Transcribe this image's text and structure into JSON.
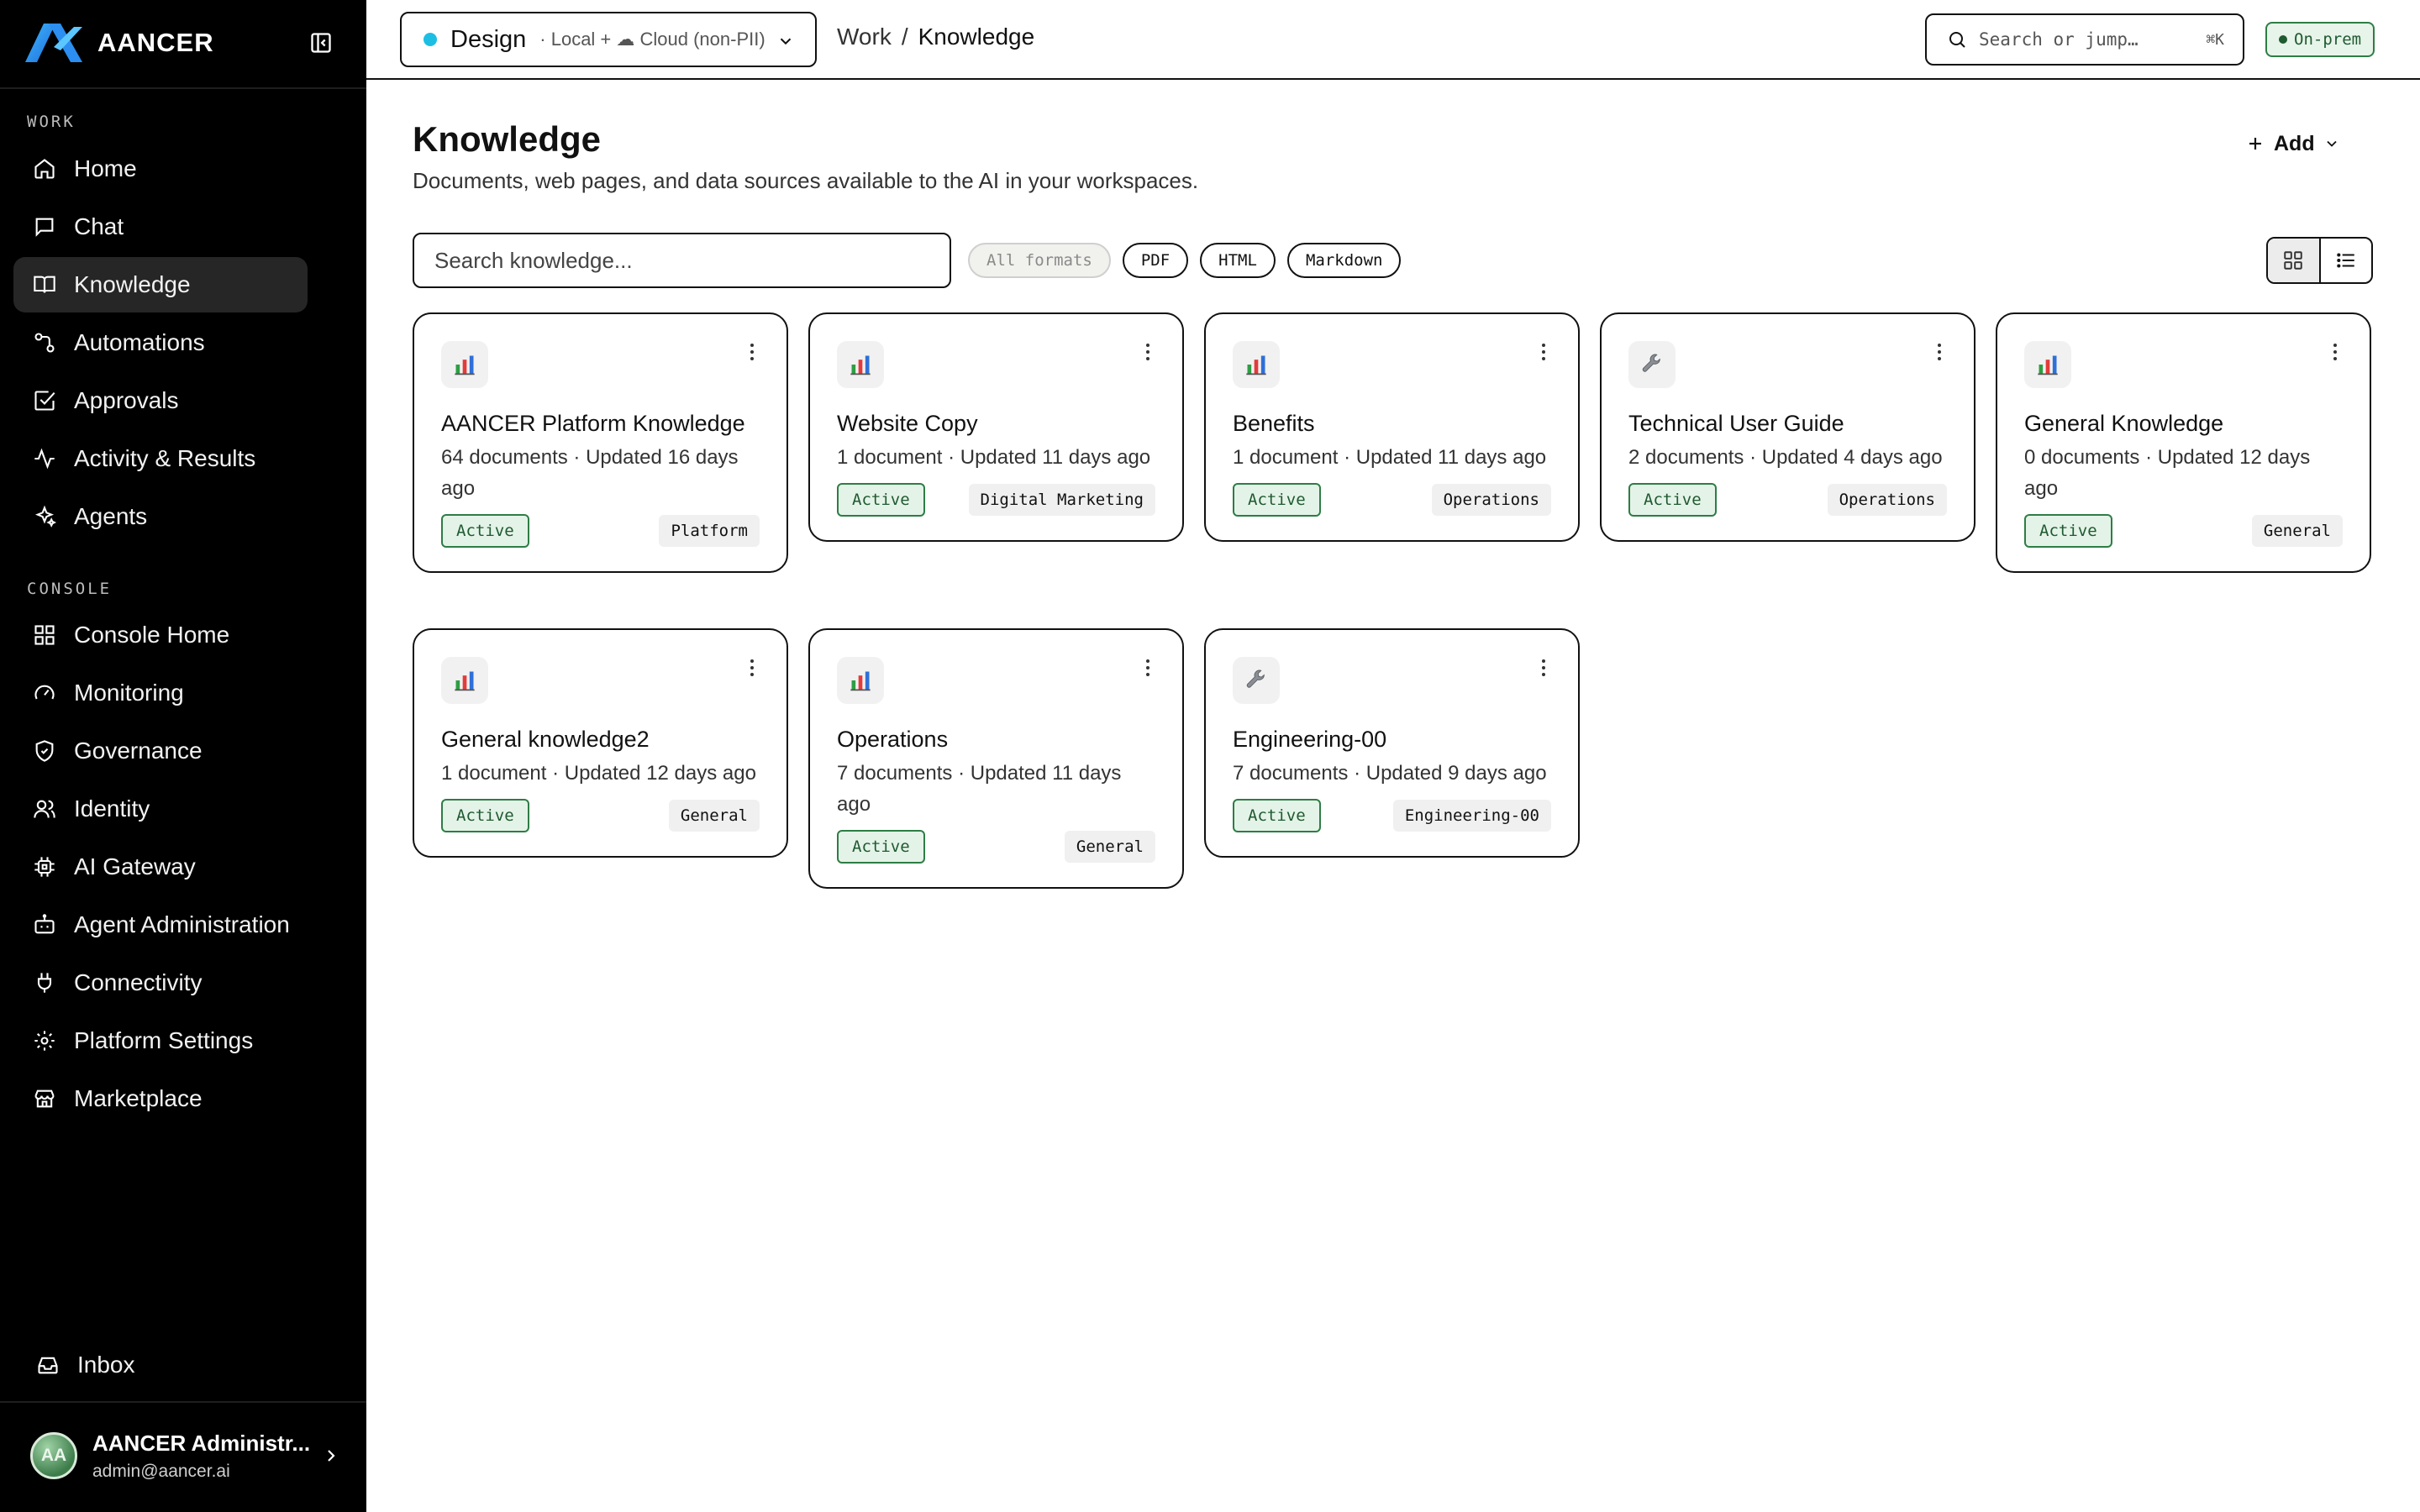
{
  "brand": {
    "name": "AANCER"
  },
  "sidebar": {
    "work_label": "WORK",
    "work_items": [
      {
        "label": "Home",
        "icon": "home-icon"
      },
      {
        "label": "Chat",
        "icon": "chat-icon"
      },
      {
        "label": "Knowledge",
        "icon": "book-icon",
        "active": true
      },
      {
        "label": "Automations",
        "icon": "workflow-icon"
      },
      {
        "label": "Approvals",
        "icon": "check-square-icon"
      },
      {
        "label": "Activity & Results",
        "icon": "activity-icon"
      },
      {
        "label": "Agents",
        "icon": "sparkles-icon"
      }
    ],
    "console_label": "CONSOLE",
    "console_items": [
      {
        "label": "Console Home",
        "icon": "grid-icon"
      },
      {
        "label": "Monitoring",
        "icon": "gauge-icon"
      },
      {
        "label": "Governance",
        "icon": "shield-icon"
      },
      {
        "label": "Identity",
        "icon": "users-icon"
      },
      {
        "label": "AI Gateway",
        "icon": "chip-icon"
      },
      {
        "label": "Agent Administration",
        "icon": "bot-icon"
      },
      {
        "label": "Connectivity",
        "icon": "plug-icon"
      },
      {
        "label": "Platform Settings",
        "icon": "gear-icon"
      },
      {
        "label": "Marketplace",
        "icon": "store-icon"
      }
    ],
    "inbox_label": "Inbox",
    "user": {
      "initials": "AA",
      "name": "AANCER Administr...",
      "email": "admin@aancer.ai"
    }
  },
  "topbar": {
    "project": {
      "name": "Design",
      "env": "· Local + ☁ Cloud (non-PII)"
    },
    "breadcrumb": {
      "parent": "Work",
      "separator": "/",
      "current": "Knowledge"
    },
    "search": {
      "placeholder": "Search or jump…",
      "shortcut": "⌘K"
    },
    "deployment_badge": "On-prem"
  },
  "main": {
    "title": "Knowledge",
    "subtitle": "Documents, web pages, and data sources available to the AI in your workspaces.",
    "add_label": "Add",
    "search_placeholder": "Search knowledge...",
    "filters": [
      "All formats",
      "PDF",
      "HTML",
      "Markdown"
    ],
    "selected_filter": "All formats",
    "view_mode": "grid",
    "cards": [
      {
        "title": "AANCER Platform Knowledge",
        "meta": "64 documents · Updated 16 days ago",
        "status": "Active",
        "tag": "Platform",
        "icon": "bar-chart-icon"
      },
      {
        "title": "Website Copy",
        "meta": "1 document · Updated 11 days ago",
        "status": "Active",
        "tag": "Digital Marketing",
        "icon": "bar-chart-icon"
      },
      {
        "title": "Benefits",
        "meta": "1 document · Updated 11 days ago",
        "status": "Active",
        "tag": "Operations",
        "icon": "bar-chart-icon"
      },
      {
        "title": "Technical User Guide",
        "meta": "2 documents · Updated 4 days ago",
        "status": "Active",
        "tag": "Operations",
        "icon": "wrench-icon"
      },
      {
        "title": "General Knowledge",
        "meta": "0 documents · Updated 12 days ago",
        "status": "Active",
        "tag": "General",
        "icon": "bar-chart-icon"
      },
      {
        "title": "General knowledge2",
        "meta": "1 document · Updated 12 days ago",
        "status": "Active",
        "tag": "General",
        "icon": "bar-chart-icon"
      },
      {
        "title": "Operations",
        "meta": "7 documents · Updated 11 days ago",
        "status": "Active",
        "tag": "General",
        "icon": "bar-chart-icon"
      },
      {
        "title": "Engineering-00",
        "meta": "7 documents · Updated 9 days ago",
        "status": "Active",
        "tag": "Engineering-00",
        "icon": "wrench-icon"
      }
    ]
  },
  "colors": {
    "sidebar_bg": "#000000",
    "active_nav_bg": "#262626",
    "status_green": "#2e7d45",
    "status_green_bg": "#e4f3e8",
    "project_dot": "#1cbfe3"
  }
}
